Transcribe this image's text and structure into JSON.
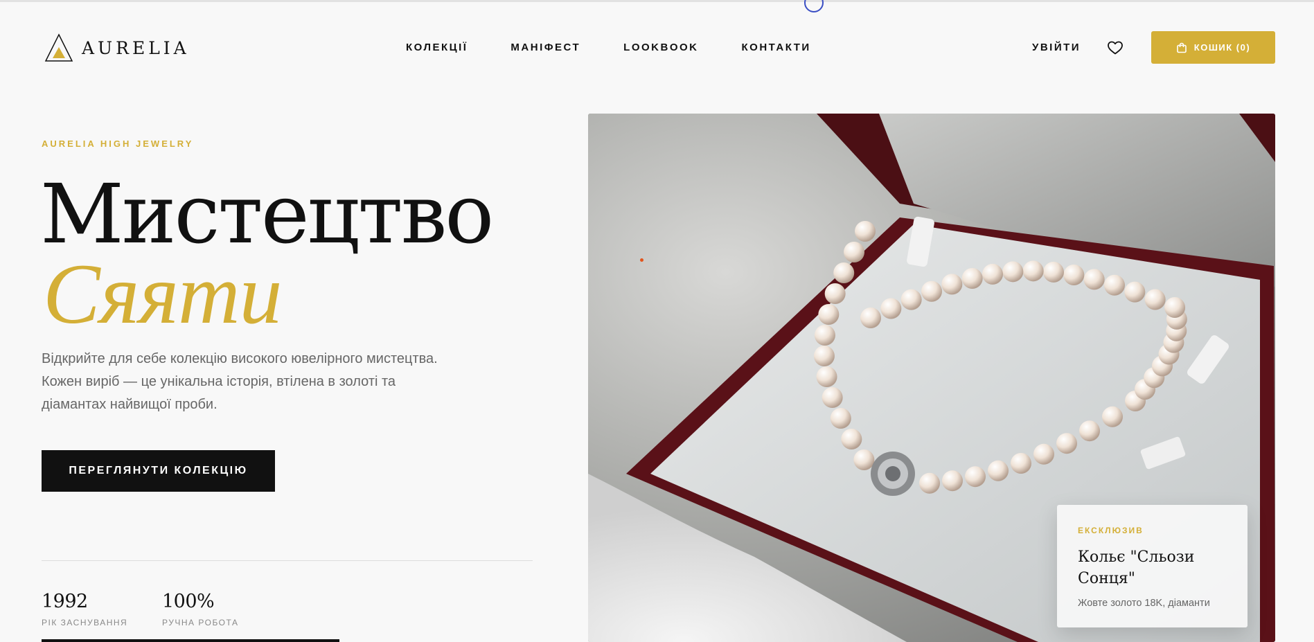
{
  "brand": {
    "name": "AURELIA"
  },
  "nav": {
    "items": [
      {
        "label": "КОЛЕКЦІЇ"
      },
      {
        "label": "МАНІФЕСТ"
      },
      {
        "label": "LOOKBOOK"
      },
      {
        "label": "КОНТАКТИ"
      }
    ]
  },
  "header": {
    "login_label": "УВІЙТИ",
    "cart_label": "КОШИК (0)"
  },
  "hero": {
    "eyebrow": "AURELIA HIGH JEWELRY",
    "title_line1": "Мистецтво",
    "title_line2": "Сяяти",
    "lead": "Відкрийте для себе колекцію високого ювелірного мистецтва. Кожен виріб — це унікальна історія, втілена в золоті та діамантах найвищої проби.",
    "cta_label": "ПЕРЕГЛЯНУТИ КОЛЕКЦІЮ",
    "stats": [
      {
        "value": "1992",
        "label": "РІК ЗАСНУВАННЯ"
      },
      {
        "value": "100%",
        "label": "РУЧНА РОБОТА"
      }
    ]
  },
  "product_card": {
    "tag": "ЕКСКЛЮЗИВ",
    "title": "Кольє \"Сльози Сонця\"",
    "subtitle": "Жовте золото 18K, діаманти"
  },
  "colors": {
    "accent": "#d4af37",
    "dark": "#111111",
    "background": "#f8f8f8",
    "muted_text": "#666666"
  },
  "icons": {
    "logo": "triangle-logo-icon",
    "wishlist": "heart-icon",
    "cart": "shopping-bag-icon"
  }
}
